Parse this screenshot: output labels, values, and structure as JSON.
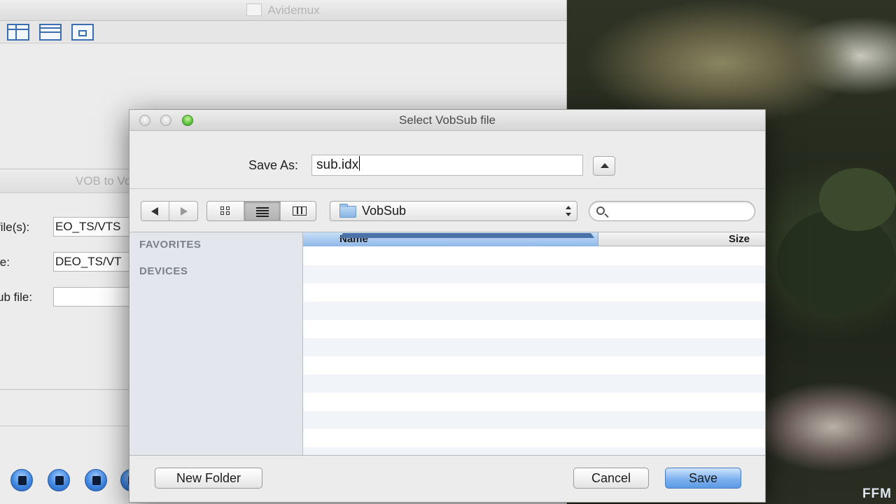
{
  "avidemux": {
    "title": "Avidemux"
  },
  "vob_window": {
    "title": "VOB to VobSub",
    "rows": [
      {
        "label": "file(s):",
        "value": "EO_TS/VTS"
      },
      {
        "label": "le:",
        "value": "DEO_TS/VT"
      },
      {
        "label": "ub file:",
        "value": ""
      }
    ]
  },
  "dialog": {
    "title": "Select VobSub file",
    "save_as_label": "Save As:",
    "save_as_value": "sub.idx",
    "folder_name": "VobSub",
    "search_placeholder": "",
    "sidebar": {
      "favorites": "FAVORITES",
      "devices": "DEVICES"
    },
    "columns": {
      "name": "Name",
      "size": "Size"
    },
    "buttons": {
      "new_folder": "New Folder",
      "cancel": "Cancel",
      "save": "Save"
    }
  },
  "watermark": "FFM",
  "colors": {
    "accent": "#5c9be6",
    "column_header_selected": "#8fb8e8",
    "sidebar_bg": "#e3e7ed"
  }
}
